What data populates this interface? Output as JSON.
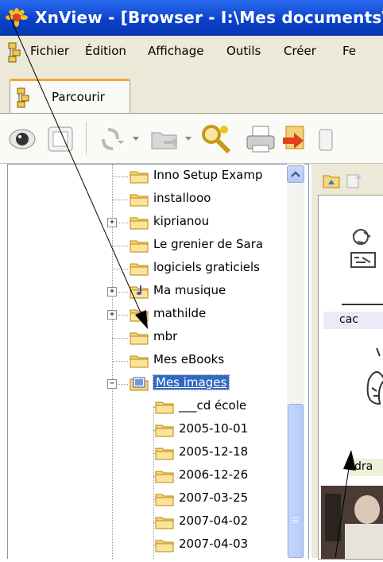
{
  "window": {
    "title": "XnView - [Browser - I:\\Mes documents\\"
  },
  "menu": [
    "Fichier",
    "Édition",
    "Affichage",
    "Outils",
    "Créer",
    "Fe"
  ],
  "tab": {
    "label": "Parcourir"
  },
  "tree": {
    "items": [
      {
        "label": "Inno Setup Examp",
        "expander": ""
      },
      {
        "label": "installooo",
        "expander": ""
      },
      {
        "label": "kiprianou",
        "expander": "+"
      },
      {
        "label": "Le grenier de Sara",
        "expander": ""
      },
      {
        "label": "logiciels graticiels",
        "expander": ""
      },
      {
        "label": "Ma musique",
        "expander": "+"
      },
      {
        "label": "mathilde",
        "expander": "+"
      },
      {
        "label": "mbr",
        "expander": ""
      },
      {
        "label": "Mes eBooks",
        "expander": ""
      },
      {
        "label": "Mes images",
        "expander": "−",
        "selected": true
      },
      {
        "label": "___cd école",
        "expander": ""
      },
      {
        "label": "2005-10-01",
        "expander": ""
      },
      {
        "label": "2005-12-18",
        "expander": ""
      },
      {
        "label": "2006-12-26",
        "expander": ""
      },
      {
        "label": "2007-03-25",
        "expander": ""
      },
      {
        "label": "2007-04-02",
        "expander": ""
      },
      {
        "label": "2007-04-03",
        "expander": ""
      }
    ]
  },
  "preview": {
    "captions": [
      "cac",
      "dra"
    ]
  },
  "colors": {
    "title_bar": "#0a3fc8",
    "selection": "#316ac5",
    "folder": "#f6d77a"
  }
}
